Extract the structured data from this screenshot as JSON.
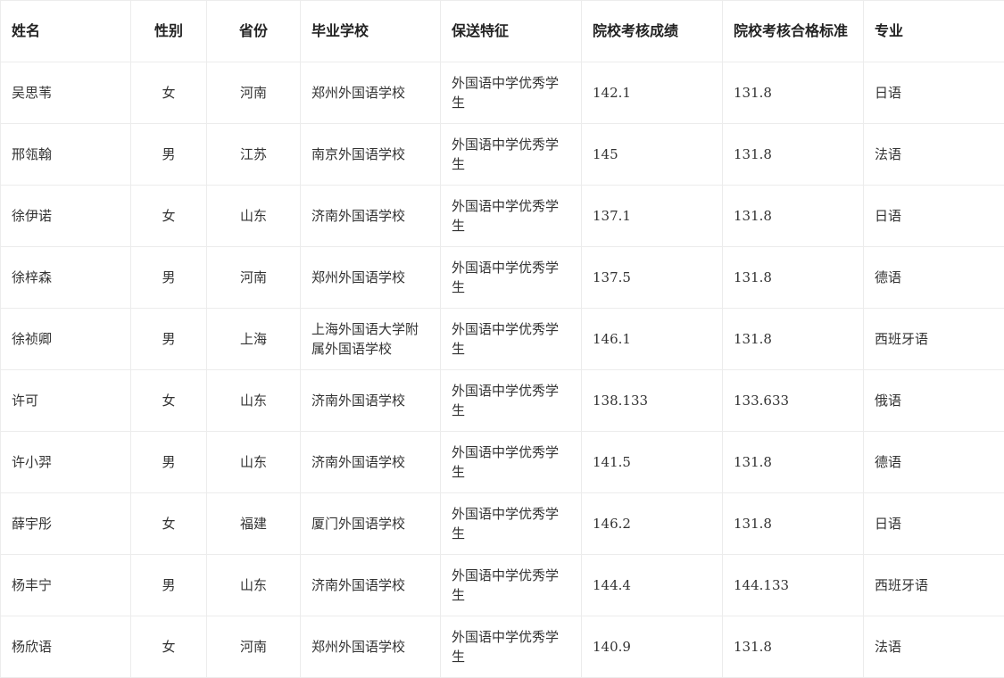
{
  "headers": [
    "姓名",
    "性别",
    "省份",
    "毕业学校",
    "保送特征",
    "院校考核成绩",
    "院校考核合格标准",
    "专业"
  ],
  "rows": [
    [
      "吴思苇",
      "女",
      "河南",
      "郑州外国语学校",
      "外国语中学优秀学生",
      "142.1",
      "131.8",
      "日语"
    ],
    [
      "邢瓴翰",
      "男",
      "江苏",
      "南京外国语学校",
      "外国语中学优秀学生",
      "145",
      "131.8",
      "法语"
    ],
    [
      "徐伊诺",
      "女",
      "山东",
      "济南外国语学校",
      "外国语中学优秀学生",
      "137.1",
      "131.8",
      "日语"
    ],
    [
      "徐梓森",
      "男",
      "河南",
      "郑州外国语学校",
      "外国语中学优秀学生",
      "137.5",
      "131.8",
      "德语"
    ],
    [
      "徐祯卿",
      "男",
      "上海",
      "上海外国语大学附属外国语学校",
      "外国语中学优秀学生",
      "146.1",
      "131.8",
      "西班牙语"
    ],
    [
      "许可",
      "女",
      "山东",
      "济南外国语学校",
      "外国语中学优秀学生",
      "138.133",
      "133.633",
      "俄语"
    ],
    [
      "许小羿",
      "男",
      "山东",
      "济南外国语学校",
      "外国语中学优秀学生",
      "141.5",
      "131.8",
      "德语"
    ],
    [
      "薛宇彤",
      "女",
      "福建",
      "厦门外国语学校",
      "外国语中学优秀学生",
      "146.2",
      "131.8",
      "日语"
    ],
    [
      "杨丰宁",
      "男",
      "山东",
      "济南外国语学校",
      "外国语中学优秀学生",
      "144.4",
      "144.133",
      "西班牙语"
    ],
    [
      "杨欣语",
      "女",
      "河南",
      "郑州外国语学校",
      "外国语中学优秀学生",
      "140.9",
      "131.8",
      "法语"
    ]
  ]
}
